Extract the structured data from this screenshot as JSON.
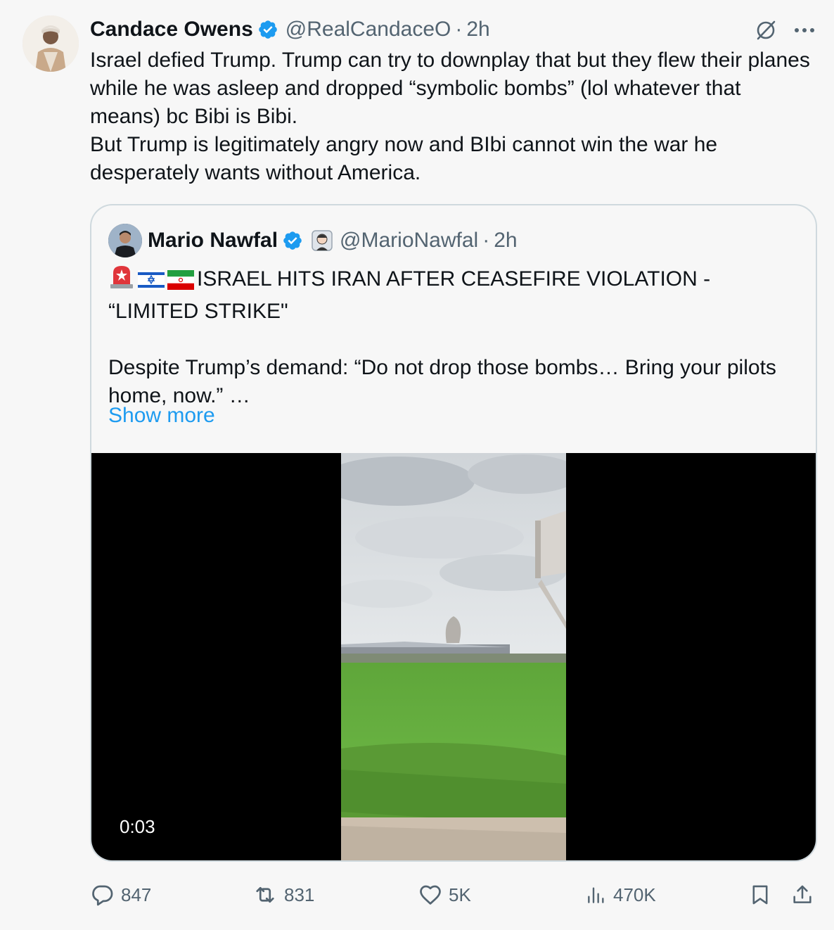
{
  "tweet": {
    "author_name": "Candace Owens",
    "author_handle": "@RealCandaceO",
    "time": "2h",
    "separator": "·",
    "text": "Israel defied Trump. Trump can try to downplay that but they flew their planes while he was asleep and dropped “symbolic bombs” (lol whatever that means) bc Bibi is Bibi.\nBut Trump is legitimately angry now and BIbi cannot win the war he desperately wants without America."
  },
  "quote": {
    "author_name": "Mario Nawfal",
    "author_handle": "@MarioNawfal",
    "time": "2h",
    "separator": "·",
    "headline": "ISRAEL HITS IRAN AFTER CEASEFIRE VIOLATION - “LIMITED STRIKE\"",
    "body": "Despite Trump’s demand: “Do not drop those bombs… Bring your pilots home, now.”  …",
    "show_more": "Show more",
    "video_time": "0:03"
  },
  "actions": {
    "replies": "847",
    "reposts": "831",
    "likes": "5K",
    "views": "470K"
  },
  "colors": {
    "verified": "#1d9bf0",
    "link": "#1d9bf0",
    "muted": "#536471",
    "border": "#cfd9de"
  },
  "icons": [
    "verified-badge-icon",
    "grok-icon",
    "more-icon",
    "emoji-avatar-icon",
    "siren-icon",
    "israel-flag-icon",
    "iran-flag-icon",
    "reply-icon",
    "repost-icon",
    "like-icon",
    "views-icon",
    "bookmark-icon",
    "share-icon"
  ]
}
